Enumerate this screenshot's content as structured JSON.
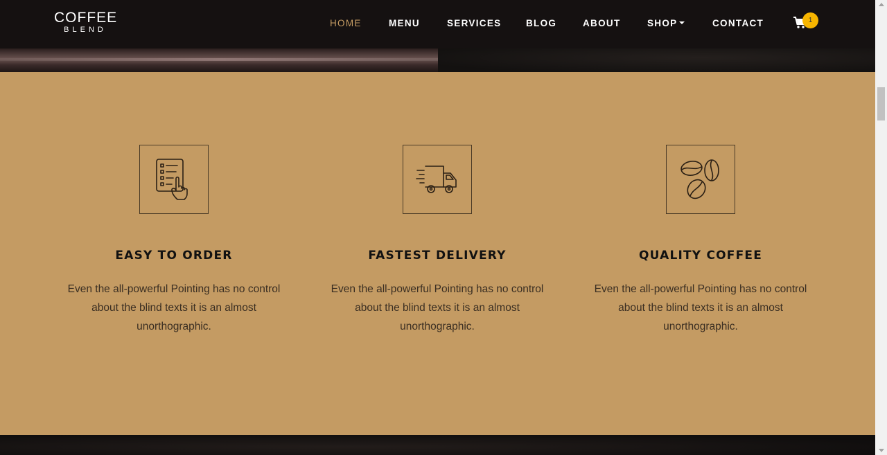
{
  "brand": {
    "main": "COFFEE",
    "sub": "BLEND"
  },
  "nav": {
    "items": [
      {
        "label": "HOME",
        "active": true
      },
      {
        "label": "MENU"
      },
      {
        "label": "SERVICES"
      },
      {
        "label": "BLOG"
      },
      {
        "label": "ABOUT"
      },
      {
        "label": "SHOP"
      },
      {
        "label": "CONTACT"
      }
    ],
    "cart_count": "1"
  },
  "features": [
    {
      "icon": "order-checklist-icon",
      "title": "EASY TO ORDER",
      "text": "Even the all-powerful Pointing has no control about the blind texts it is an almost unorthographic."
    },
    {
      "icon": "delivery-truck-icon",
      "title": "FASTEST DELIVERY",
      "text": "Even the all-powerful Pointing has no control about the blind texts it is an almost unorthographic."
    },
    {
      "icon": "coffee-beans-icon",
      "title": "QUALITY COFFEE",
      "text": "Even the all-powerful Pointing has no control about the blind texts it is an almost unorthographic."
    }
  ],
  "colors": {
    "accent": "#c49b63",
    "navbar": "#151111",
    "badge": "#f7b500"
  }
}
